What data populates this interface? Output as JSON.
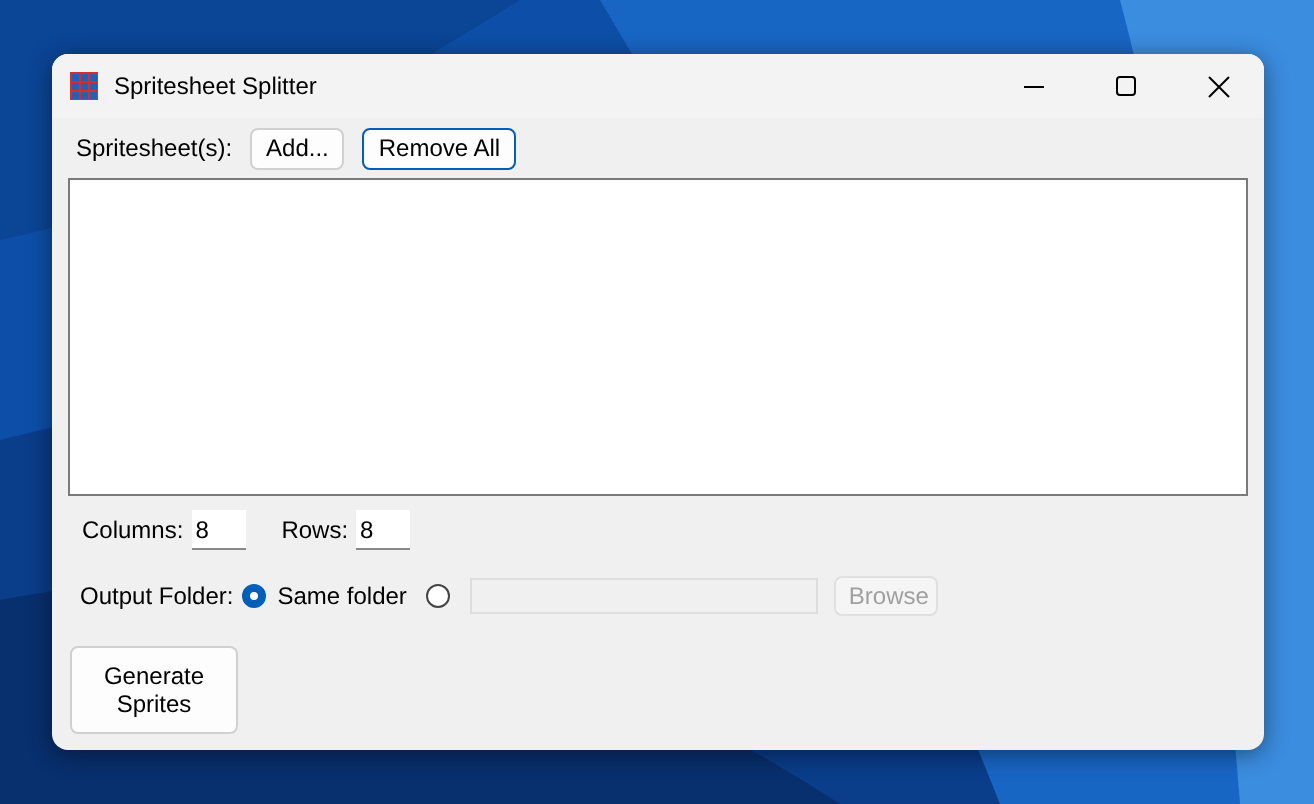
{
  "window": {
    "title": "Spritesheet Splitter"
  },
  "spritesheets": {
    "label": "Spritesheet(s):",
    "buttons": [
      {
        "label": "Add...",
        "focused": false
      },
      {
        "label": "Remove All",
        "focused": true
      }
    ]
  },
  "grid": {
    "columns": {
      "label": "Columns:",
      "value": "8"
    },
    "rows": {
      "label": "Rows:",
      "value": "8"
    }
  },
  "output": {
    "label": "Output Folder:",
    "options": [
      {
        "kind": "same",
        "label": "Same folder",
        "selected": true
      },
      {
        "kind": "custom",
        "selected": false
      }
    ],
    "path_field": {
      "disabled": true
    },
    "browse": {
      "label": "Browse",
      "disabled": true
    }
  },
  "generate": {
    "label": "Generate Sprites"
  }
}
